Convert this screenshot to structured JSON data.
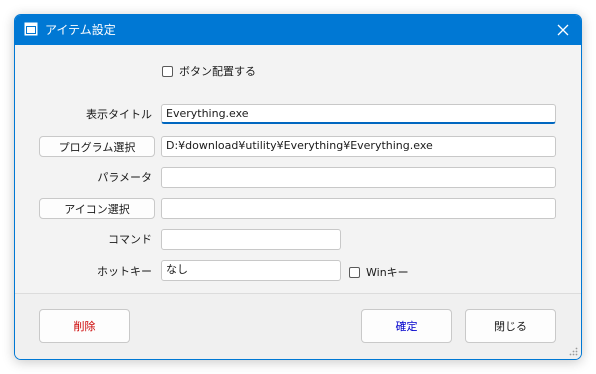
{
  "window": {
    "title": "アイテム設定",
    "accent_color": "#0078d4",
    "close_icon": "close-icon"
  },
  "form": {
    "button_place_checkbox": {
      "label": "ボタン配置する",
      "checked": false
    },
    "display_title": {
      "label": "表示タイトル",
      "value": "Everything.exe"
    },
    "program": {
      "button_label": "プログラム選択",
      "value": "D:¥download¥utility¥Everything¥Everything.exe"
    },
    "parameter": {
      "label": "パラメータ",
      "value": ""
    },
    "icon": {
      "button_label": "アイコン選択",
      "value": ""
    },
    "command": {
      "label": "コマンド",
      "value": ""
    },
    "hotkey": {
      "label": "ホットキー",
      "value": "なし"
    },
    "win_key_checkbox": {
      "label": "Winキー",
      "checked": false
    }
  },
  "footer": {
    "delete_label": "削除",
    "delete_color": "#cc0000",
    "ok_label": "確定",
    "ok_color": "#0000cc",
    "close_label": "閉じる"
  }
}
